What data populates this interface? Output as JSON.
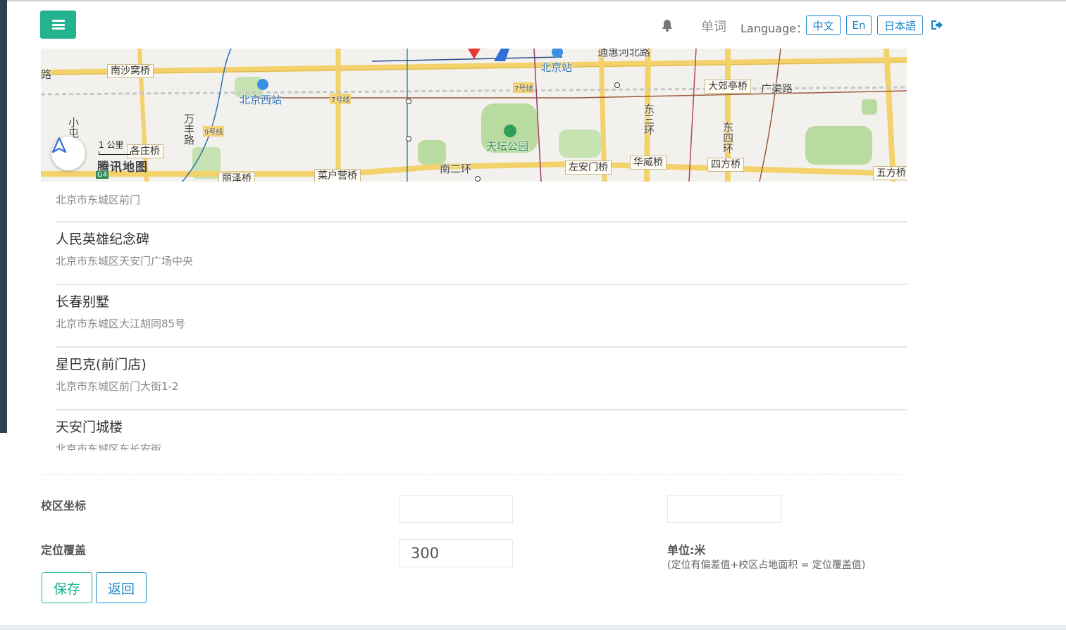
{
  "header": {
    "words_label": "单词",
    "language_label": "Language：",
    "languages": [
      "中文",
      "En",
      "日本語"
    ],
    "icons": {
      "menu": "bars-icon",
      "notification": "bell-icon",
      "logout": "sign-out-icon"
    }
  },
  "map": {
    "road_labels": [
      "南沙窝桥",
      "各庄桥",
      "丽泽桥",
      "菜户营桥",
      "左安门桥",
      "华威桥",
      "四方桥",
      "五方桥",
      "大郊亭桥"
    ],
    "place_labels": [
      "北京西站",
      "北京站",
      "天坛公园",
      "南二环",
      "广渠路",
      "通惠河北路",
      "东三环",
      "东四环",
      "万丰路",
      "小屯",
      "路"
    ],
    "line_badges": [
      "9号线",
      "7号线",
      "7号线"
    ],
    "scale_text": "1 公里",
    "logo_text": "腾讯地图",
    "highway_badge": "G4",
    "colors": {
      "background": "#f3f1ed",
      "arterial": "#f3d26b",
      "green": "#b9dba0",
      "rail": "#c9c9c9"
    }
  },
  "poi_list": [
    {
      "name": "",
      "address": "北京市东城区前门"
    },
    {
      "name": "人民英雄纪念碑",
      "address": "北京市东城区天安门广场中央"
    },
    {
      "name": "长春别墅",
      "address": "北京市东城区大江胡同85号"
    },
    {
      "name": "星巴克(前门店)",
      "address": "北京市东城区前门大街1-2"
    },
    {
      "name": "天安门城楼",
      "address": "北京市东城区东长安街"
    }
  ],
  "form": {
    "coord_label": "校区坐标",
    "lat_value": "",
    "lng_value": "",
    "radius_label": "定位覆盖",
    "radius_value": "300",
    "unit_label": "单位:米",
    "unit_note": "(定位有偏差值+校区占地面积 = 定位覆盖值)"
  },
  "actions": {
    "save_label": "保存",
    "back_label": "返回"
  },
  "colors": {
    "primary": "#1ab394",
    "info": "#1c84c6",
    "sidebar": "#2f4050"
  }
}
